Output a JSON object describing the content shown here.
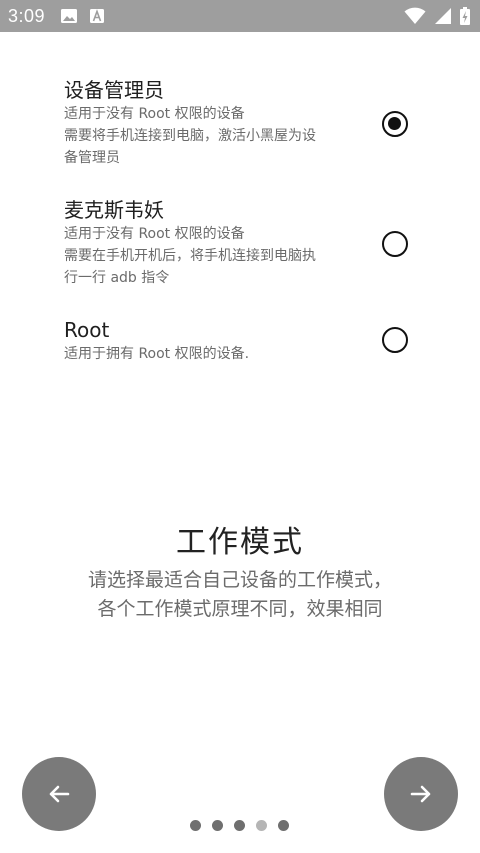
{
  "status_bar": {
    "time": "3:09",
    "left_icons": [
      "image-icon",
      "app-a-icon"
    ],
    "right_icons": [
      "wifi-icon",
      "cellular-signal-icon",
      "battery-icon"
    ]
  },
  "modes": [
    {
      "title": "设备管理员",
      "desc_lines": [
        "适用于没有 Root 权限的设备",
        "需要将手机连接到电脑，激活小黑屋为设",
        "备管理员"
      ],
      "selected": true
    },
    {
      "title": "麦克斯韦妖",
      "desc_lines": [
        "适用于没有 Root 权限的设备",
        "需要在手机开机后，将手机连接到电脑执",
        "行一行 adb 指令"
      ],
      "selected": false
    },
    {
      "title": "Root",
      "desc_lines": [
        "适用于拥有 Root 权限的设备."
      ],
      "selected": false
    }
  ],
  "intro": {
    "title": "工作模式",
    "subtitle_lines": [
      "请选择最适合自己设备的工作模式，",
      "各个工作模式原理不同，效果相同"
    ]
  },
  "navigation": {
    "back_icon": "arrow-left-icon",
    "next_icon": "arrow-right-icon",
    "page_count": 5,
    "current_page": 4
  },
  "colors": {
    "status_bar": "#9e9e9e",
    "nav_button": "#7a7a7a",
    "dot": "#6f6f6f",
    "dot_active": "#b5b5b5"
  }
}
